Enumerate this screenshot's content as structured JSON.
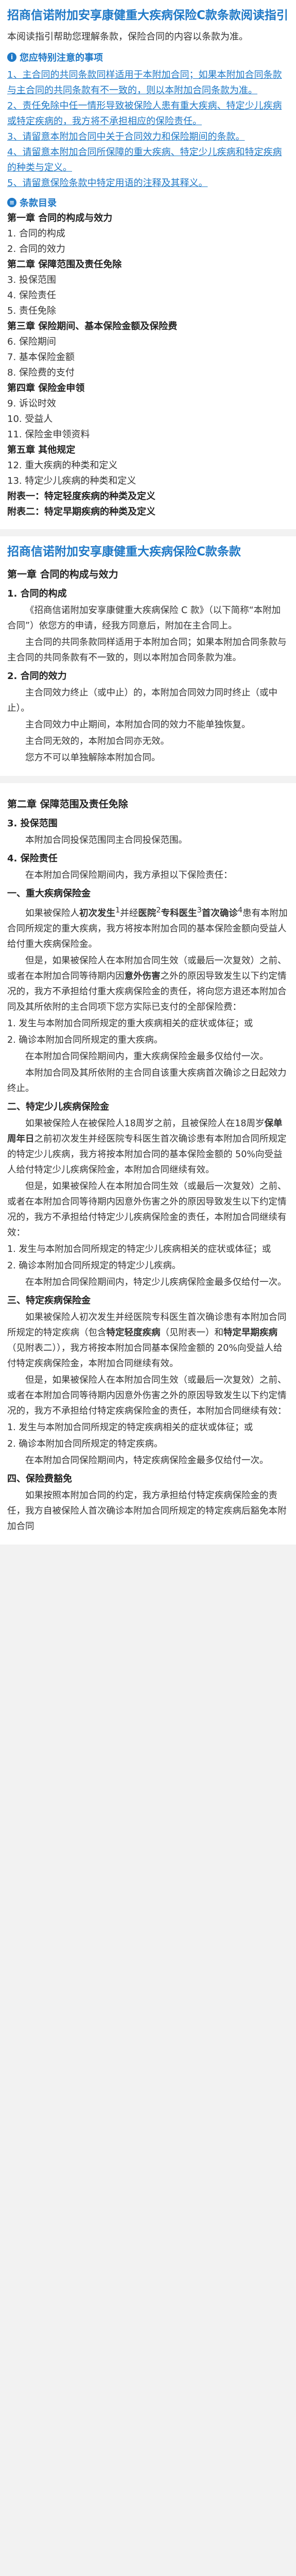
{
  "guide": {
    "title": "招商信诺附加安享康健重大疾病保险C款条款阅读指引",
    "intro": "本阅读指引帮助您理解条款，保险合同的内容以条款为准。",
    "notes_heading": "您应特别注意的事项",
    "notes": [
      "1、主合同的共同条款同样适用于本附加合同；如果本附加合同条款与主合同的共同条款有不一致的，则以本附加合同条款为准。",
      "2、责任免除中任一情形导致被保险人患有重大疾病、特定少儿疾病或特定疾病的，我方将不承担相应的保险责任。",
      "3、请留意本附加合同中关于合同效力和保险期间的条款。",
      "4、请留意本附加合同所保障的重大疾病、特定少儿疾病和特定疾病的种类与定义。",
      "5、请留意保险条款中特定用语的注释及其释义。"
    ],
    "toc_heading": "条款目录",
    "toc": [
      {
        "text": "第一章 合同的构成与效力",
        "bold": true
      },
      {
        "text": "1. 合同的构成",
        "bold": false
      },
      {
        "text": "2. 合同的效力",
        "bold": false
      },
      {
        "text": "第二章 保障范围及责任免除",
        "bold": true
      },
      {
        "text": "3. 投保范围",
        "bold": false
      },
      {
        "text": "4. 保险责任",
        "bold": false
      },
      {
        "text": "5. 责任免除",
        "bold": false
      },
      {
        "text": "第三章 保险期间、基本保险金额及保险费",
        "bold": true
      },
      {
        "text": "6. 保险期间",
        "bold": false
      },
      {
        "text": "7. 基本保险金额",
        "bold": false
      },
      {
        "text": "8. 保险费的支付",
        "bold": false
      },
      {
        "text": "第四章 保险金申领",
        "bold": true
      },
      {
        "text": "9. 诉讼时效",
        "bold": false
      },
      {
        "text": "10. 受益人",
        "bold": false
      },
      {
        "text": "11. 保险金申领资料",
        "bold": false
      },
      {
        "text": "第五章 其他规定",
        "bold": true
      },
      {
        "text": "12. 重大疾病的种类和定义",
        "bold": false
      },
      {
        "text": "13. 特定少儿疾病的种类和定义",
        "bold": false
      },
      {
        "text": "附表一：特定轻度疾病的种类及定义",
        "bold": true
      },
      {
        "text": "附表二：特定早期疾病的种类及定义",
        "bold": true
      }
    ]
  },
  "clause": {
    "title": "招商信诺附加安享康健重大疾病保险C款条款",
    "ch1": "第一章 合同的构成与效力",
    "s1_title": "1. 合同的构成",
    "s1_p1": "《招商信诺附加安享康健重大疾病保险 C 款》（以下简称“本附加合同”）依您方的申请，经我方同意后，附加在主合同上。",
    "s1_p2": "主合同的共同条款同样适用于本附加合同；如果本附加合同条款与主合同的共同条款有不一致的，则以本附加合同条款为准。",
    "s2_title": "2. 合同的效力",
    "s2_p1": "主合同效力终止（或中止）的，本附加合同效力同时终止（或中止）。",
    "s2_p2": "主合同效力中止期间，本附加合同的效力不能单独恢复。",
    "s2_p3": "主合同无效的，本附加合同亦无效。",
    "s2_p4": "您方不可以单独解除本附加合同。",
    "ch2": "第二章 保障范围及责任免除",
    "s3_title": "3. 投保范围",
    "s3_p1": "本附加合同投保范围同主合同投保范围。",
    "s4_title": "4. 保险责任",
    "s4_p1": "在本附加合同保险期间内，我方承担以下保险责任：",
    "s4_1_title": "一、重大疾病保险金",
    "s4_1_p1a": "如果被保险人",
    "s4_1_hl1": "初次发生",
    "s4_1_p1b": "1",
    "s4_1_p1c": "并经",
    "s4_1_hl2": "医院",
    "s4_1_p1d": "2",
    "s4_1_hl3": "专科医生",
    "s4_1_p1e": "3",
    "s4_1_hl4": "首次确诊",
    "s4_1_p1f": "4",
    "s4_1_p1g": "患有本附加合同所规定的重大疾病，我方将按本附加合同的基本保险金额向受益人给付重大疾病保险金。",
    "s4_1_p2a": "但是，如果被保险人在本附加合同生效（或最后一次复效）之前、或者在本附加合同等待期内因",
    "s4_1_p2b": "意外伤害",
    "s4_1_p2c": "之外的原因导致发生以下约定情况的，我方不承担给付重大疾病保险金的责任，将向您方退还本附加合同及其所依附的主合同项下您方实际已支付的全部保险费：",
    "s4_1_li1": "1. 发生与本附加合同所规定的重大疾病相关的症状或体征；或",
    "s4_1_li2": "2. 确诊本附加合同所规定的重大疾病。",
    "s4_1_p3": "在本附加合同保险期间内，重大疾病保险金最多仅给付一次。",
    "s4_1_p4": "本附加合同及其所依附的主合同自该重大疾病首次确诊之日起效力终止。",
    "s4_2_title": "二、特定少儿疾病保险金",
    "s4_2_p1a": "如果被保险人在被保险人18周岁",
    "s4_2_p1b": "之前，且被保险人在18周岁",
    "s4_2_hl1": "保单周年日",
    "s4_2_p1c": "之前初次发生并经医院专科医生首次确诊患有本附加合同所规定的特定少儿疾病，我方将按本附加合同的基本保险金额的 50%向受益人给付特定少儿疾病保险金，本附加合同继续有效。",
    "s4_2_p2": "但是，如果被保险人在本附加合同生效（或最后一次复效）之前、或者在本附加合同等待期内因意外伤害之外的原因导致发生以下约定情况的，我方不承担给付特定少儿疾病保险金的责任，本附加合同继续有效：",
    "s4_2_li1": "1. 发生与本附加合同所规定的特定少儿疾病相关的症状或体征；或",
    "s4_2_li2": "2. 确诊本附加合同所规定的特定少儿疾病。",
    "s4_2_p3": "在本附加合同保险期间内，特定少儿疾病保险金最多仅给付一次。",
    "s4_3_title": "三、特定疾病保险金",
    "s4_3_p1a": "如果被保险人初次发生并经医院专科医生首次确诊患有本附加合同所规定的特定疾病（包含",
    "s4_3_hl1": "特定轻度疾病",
    "s4_3_p1b": "（见附表一）和",
    "s4_3_hl2": "特定早期疾病",
    "s4_3_p1c": "（见附表二）），我方将按本附加合同基本保险金额的 20%向受益人给付特定疾病保险金，本附加合同继续有效。",
    "s4_3_p2": "但是，如果被保险人在本附加合同生效（或最后一次复效）之前、或者在本附加合同等待期内因意外伤害之外的原因导致发生以下约定情况的，我方不承担给付特定疾病保险金的责任，本附加合同继续有效：",
    "s4_3_li1": "1. 发生与本附加合同所规定的特定疾病相关的症状或体征；或",
    "s4_3_li2": "2. 确诊本附加合同所规定的特定疾病。",
    "s4_3_p3": "在本附加合同保险期间内，特定疾病保险金最多仅给付一次。",
    "s4_4_title": "四、保险费豁免",
    "s4_4_p1": "如果按照本附加合同的约定，我方承担给付特定疾病保险金的责任，我方自被保险人首次确诊本附加合同所规定的特定疾病后豁免本附加合同"
  }
}
